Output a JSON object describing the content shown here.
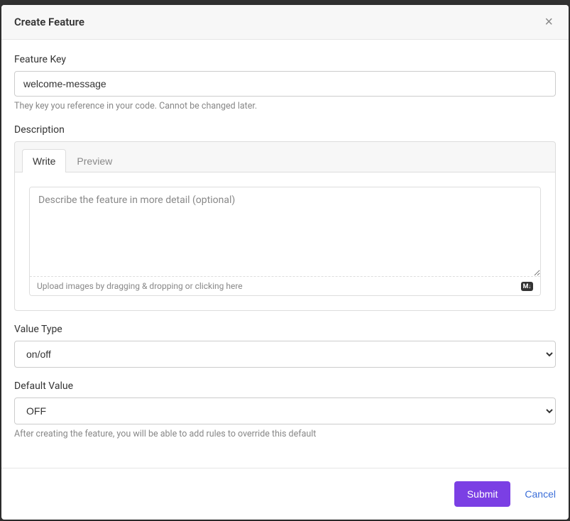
{
  "modal": {
    "title": "Create Feature"
  },
  "featureKey": {
    "label": "Feature Key",
    "value": "welcome-message",
    "help": "They key you reference in your code. Cannot be changed later."
  },
  "description": {
    "label": "Description",
    "tabs": {
      "write": "Write",
      "preview": "Preview"
    },
    "placeholder": "Describe the feature in more detail (optional)",
    "value": "",
    "uploadHint": "Upload images by dragging & dropping or clicking here",
    "mdBadge": "M↓"
  },
  "valueType": {
    "label": "Value Type",
    "value": "on/off",
    "options": [
      "on/off"
    ]
  },
  "defaultValue": {
    "label": "Default Value",
    "value": "OFF",
    "options": [
      "OFF"
    ],
    "help": "After creating the feature, you will be able to add rules to override this default"
  },
  "actions": {
    "submit": "Submit",
    "cancel": "Cancel"
  }
}
